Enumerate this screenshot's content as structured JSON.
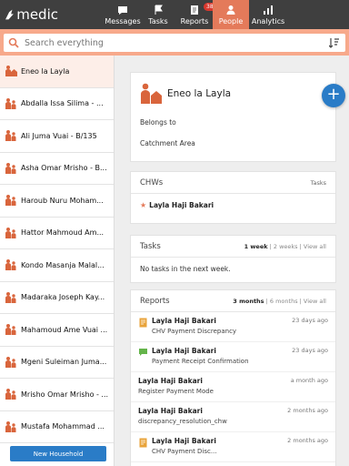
{
  "app": {
    "logo_text": "medic"
  },
  "nav": [
    {
      "label": "Messages",
      "icon": "messages-icon"
    },
    {
      "label": "Tasks",
      "icon": "tasks-icon"
    },
    {
      "label": "Reports",
      "icon": "reports-icon",
      "badge": "38"
    },
    {
      "label": "People",
      "icon": "people-icon",
      "active": true
    },
    {
      "label": "Analytics",
      "icon": "analytics-icon"
    }
  ],
  "search": {
    "placeholder": "Search everything"
  },
  "people": [
    "Eneo la Layla",
    "Abdalla Issa Silima - ...",
    "Ali Juma Vuai - B/135",
    "Asha Omar Mrisho - B...",
    "Haroub Nuru Moham...",
    "Hattor Mahmoud Am...",
    "Kondo Masanja Malal...",
    "Madaraka Joseph Kay...",
    "Mahamoud Ame Vuai ...",
    "Mgeni Suleiman Juma...",
    "Mrisho Omar Mrisho - ...",
    "Mustafa Mohammad ..."
  ],
  "new_household_label": "New Household",
  "place": {
    "name": "Eneo la Layla",
    "belongs_to_label": "Belongs to",
    "catchment_label": "Catchment Area"
  },
  "chws": {
    "title": "CHWs",
    "tasks_label": "Tasks",
    "name": "Layla Haji Bakari"
  },
  "tasks": {
    "title": "Tasks",
    "filter_active": "1 week",
    "filter_2": "2 weeks",
    "filter_3": "View all",
    "empty": "No tasks in the next week."
  },
  "reports": {
    "title": "Reports",
    "filter_active": "3 months",
    "filter_2": "6 months",
    "filter_3": "View all",
    "items": [
      {
        "name": "Layla Haji Bakari",
        "date": "23 days ago",
        "form": "CHV Payment Discrepancy",
        "icon": "document-icon"
      },
      {
        "name": "Layla Haji Bakari",
        "date": "23 days ago",
        "form": "Payment Receipt Confirmation",
        "icon": "message-icon"
      },
      {
        "name": "Layla Haji Bakari",
        "date": "a month ago",
        "form": "Register Payment Mode",
        "icon": "none"
      },
      {
        "name": "Layla Haji Bakari",
        "date": "2 months ago",
        "form": "discrepancy_resolution_chw",
        "icon": "none"
      },
      {
        "name": "Layla Haji Bakari",
        "date": "2 months ago",
        "form": "CHV Payment Disc...",
        "icon": "document-icon"
      }
    ]
  },
  "colors": {
    "topbar": "#3f3f3f",
    "accent": "#e47a5a",
    "search_bg": "#f7a98b",
    "primary": "#2a7cc7",
    "person_icon": "#d9653c"
  }
}
